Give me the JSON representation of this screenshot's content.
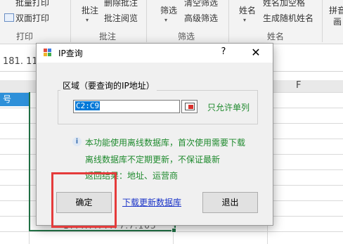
{
  "ribbon": {
    "group1_items": [
      "批量打印",
      "双面打印"
    ],
    "group1_label": "打印",
    "group2_main": "批注",
    "group2_items": [
      "删除批注",
      "批注阅览"
    ],
    "group2_label": "批注",
    "group3_main": "筛选",
    "group3_items": [
      "清空筛选",
      "高级筛选"
    ],
    "group3_label": "筛选",
    "group4_main": "姓名",
    "group4_items": [
      "姓名加空格",
      "生成随机姓名"
    ],
    "group4_label": "姓名",
    "group5_items": [
      "拼音",
      "画"
    ]
  },
  "formula_bar": {
    "text": "181. 11"
  },
  "sheet": {
    "col_header_selected": "号",
    "col_f": "F",
    "ghost_ip": "17.4.7.77.77.7.103"
  },
  "dialog": {
    "title": "IP查询",
    "help_label": "?",
    "close_label": "✕",
    "group_label": "区域（要查询的IP地址）",
    "range_value": "C2:C9",
    "only_single": "只允许单列",
    "info_icon": "i",
    "info_lines": [
      "本功能使用离线数据库，首次使用需要下载",
      "离线数据库不定期更新，不保证最新",
      "返回结果：地址、运营商"
    ],
    "ok_label": "确定",
    "download_link": "下载更新数据库",
    "exit_label": "退出"
  },
  "colors": {
    "accent_green": "#1f8a2e",
    "selection_blue": "#0078d7",
    "highlight_red": "#e53b3b",
    "excel_green": "#217346"
  }
}
